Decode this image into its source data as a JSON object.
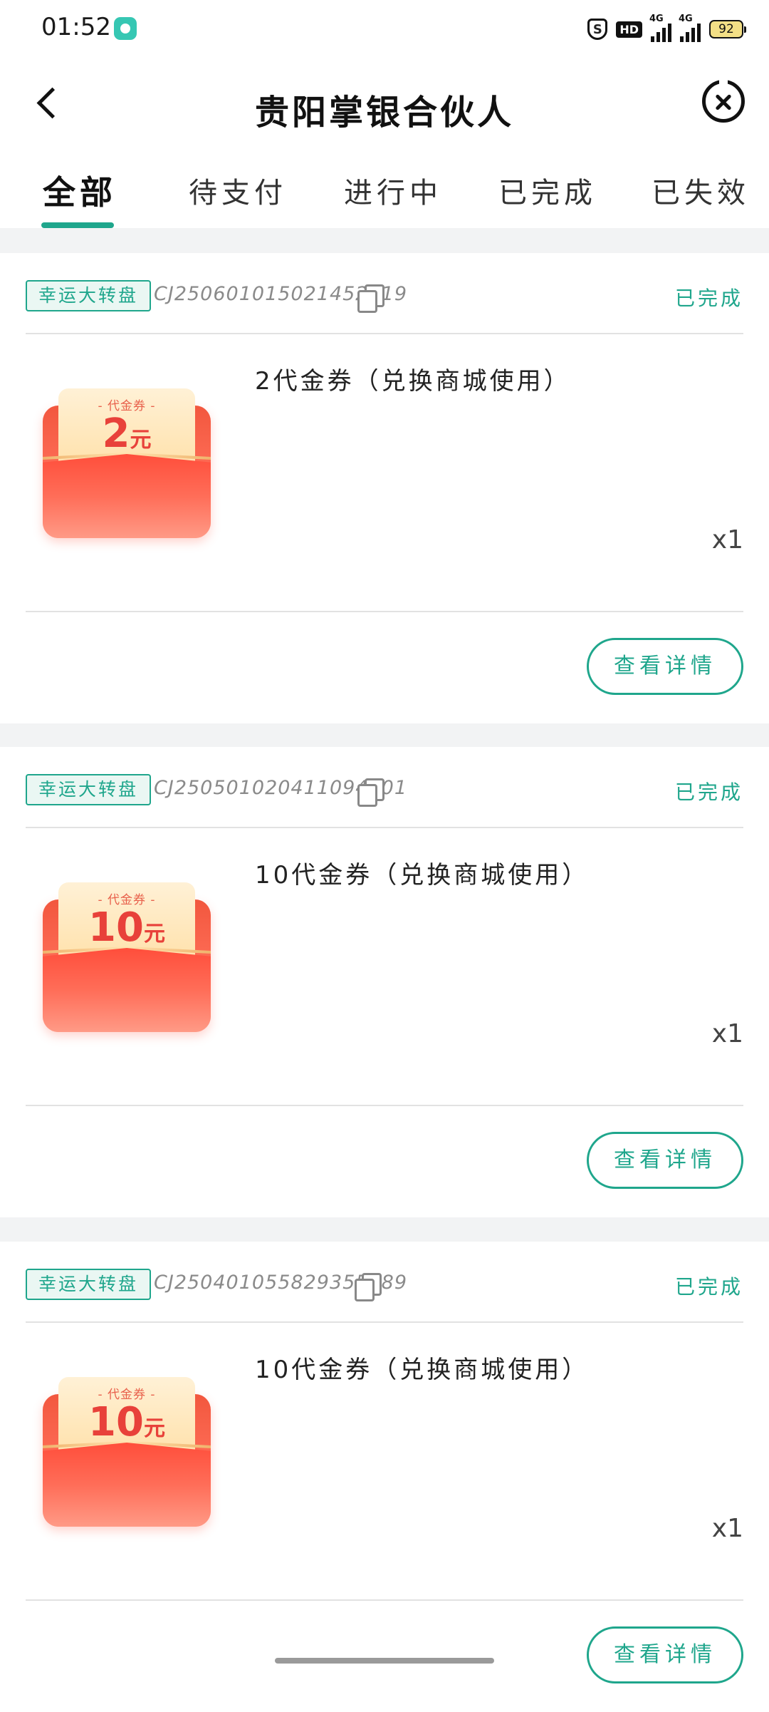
{
  "status_bar": {
    "time": "01:52",
    "icons": [
      "app-notification-icon",
      "shield-s-icon",
      "hd-icon",
      "signal-4g-icon",
      "signal-4g-icon",
      "battery-icon"
    ],
    "hd_label": "HD",
    "signal1_label": "4G",
    "signal2_label": "4G",
    "battery_level": "92"
  },
  "nav": {
    "title": "贵阳掌银合伙人"
  },
  "tabs": [
    {
      "label": "全部",
      "active": true
    },
    {
      "label": "待支付",
      "active": false
    },
    {
      "label": "进行中",
      "active": false
    },
    {
      "label": "已完成",
      "active": false
    },
    {
      "label": "已失效",
      "active": false
    }
  ],
  "orders": [
    {
      "tag": "幸运大转盘",
      "order_no": "CJ250601015021452319",
      "status": "已完成",
      "coupon_label": "- 代金券 -",
      "coupon_amount": "2",
      "coupon_unit": "元",
      "product_name": "2代金券（兑换商城使用）",
      "quantity": "x1",
      "button": "查看详情"
    },
    {
      "tag": "幸运大转盘",
      "order_no": "CJ250501020411094601",
      "status": "已完成",
      "coupon_label": "- 代金券 -",
      "coupon_amount": "10",
      "coupon_unit": "元",
      "product_name": "10代金券（兑换商城使用）",
      "quantity": "x1",
      "button": "查看详情"
    },
    {
      "tag": "幸运大转盘",
      "order_no": "CJ250401055829355689",
      "status": "已完成",
      "coupon_label": "- 代金券 -",
      "coupon_amount": "10",
      "coupon_unit": "元",
      "product_name": "10代金券（兑换商城使用）",
      "quantity": "x1",
      "button": "查看详情"
    }
  ],
  "colors": {
    "accent": "#1fa68c",
    "background": "#f2f3f4",
    "coupon_red": "#e8413a"
  }
}
